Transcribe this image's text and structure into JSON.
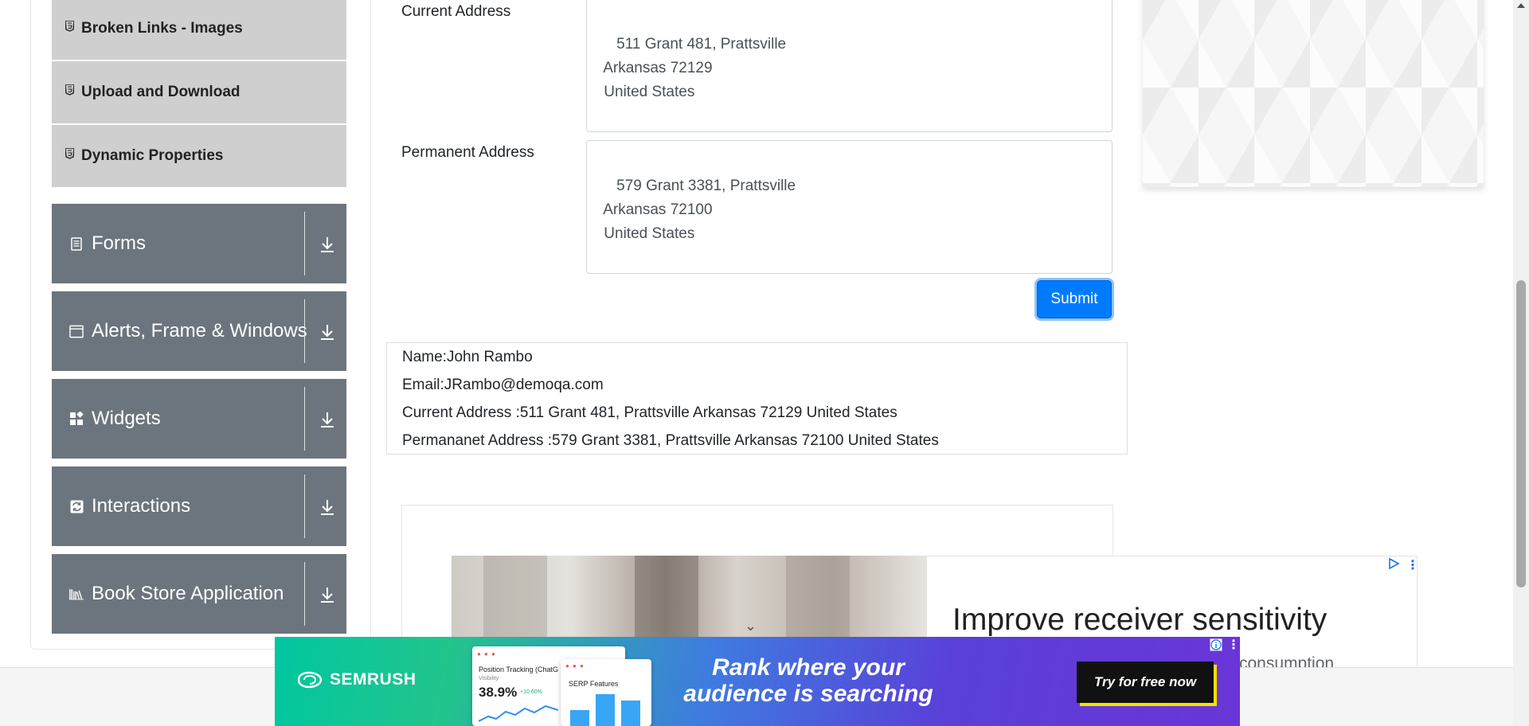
{
  "sidebar": {
    "sub_items": [
      {
        "label": "Broken Links - Images",
        "icon": "html5-icon"
      },
      {
        "label": "Upload and Download",
        "icon": "html5-icon"
      },
      {
        "label": "Dynamic Properties",
        "icon": "html5-icon"
      }
    ],
    "groups": [
      {
        "label": "Forms",
        "icon": "document-icon"
      },
      {
        "label": "Alerts, Frame & Windows",
        "icon": "browser-window-icon"
      },
      {
        "label": "Widgets",
        "icon": "widgets-icon"
      },
      {
        "label": "Interactions",
        "icon": "refresh-icon"
      },
      {
        "label": "Book Store Application",
        "icon": "books-icon"
      }
    ]
  },
  "form": {
    "current_address_label": "Current Address",
    "current_address_value": "511 Grant 481, Prattsville\n Arkansas 72129\n United States",
    "permanent_address_label": "Permanent Address",
    "permanent_address_value": "579 Grant 3381, Prattsville\n Arkansas 72100\n United States",
    "submit_label": "Submit"
  },
  "output": {
    "name": "Name:John Rambo",
    "email": "Email:JRambo@demoqa.com",
    "current_address": "Current Address :511 Grant 481, Prattsville Arkansas 72129 United States",
    "permanent_address": "Permananet Address :579 Grant 3381, Prattsville Arkansas 72100 United States"
  },
  "ad": {
    "title": "Improve receiver sensitivity",
    "subtitle": "consumption"
  },
  "banner": {
    "brand": "SEMRUSH",
    "screenshot_title": "Position Tracking (ChatG",
    "screenshot_metric_label": "Visibility",
    "screenshot_metric": "38.9%",
    "screenshot_delta": "+10.60%",
    "serp_title": "SERP Features",
    "headline": "Rank where your audience is searching",
    "cta": "Try for free now"
  },
  "colors": {
    "sidebar_group_bg": "#6c757d",
    "sidebar_sub_bg": "#cfcfcf",
    "submit_bg": "#007bff"
  }
}
